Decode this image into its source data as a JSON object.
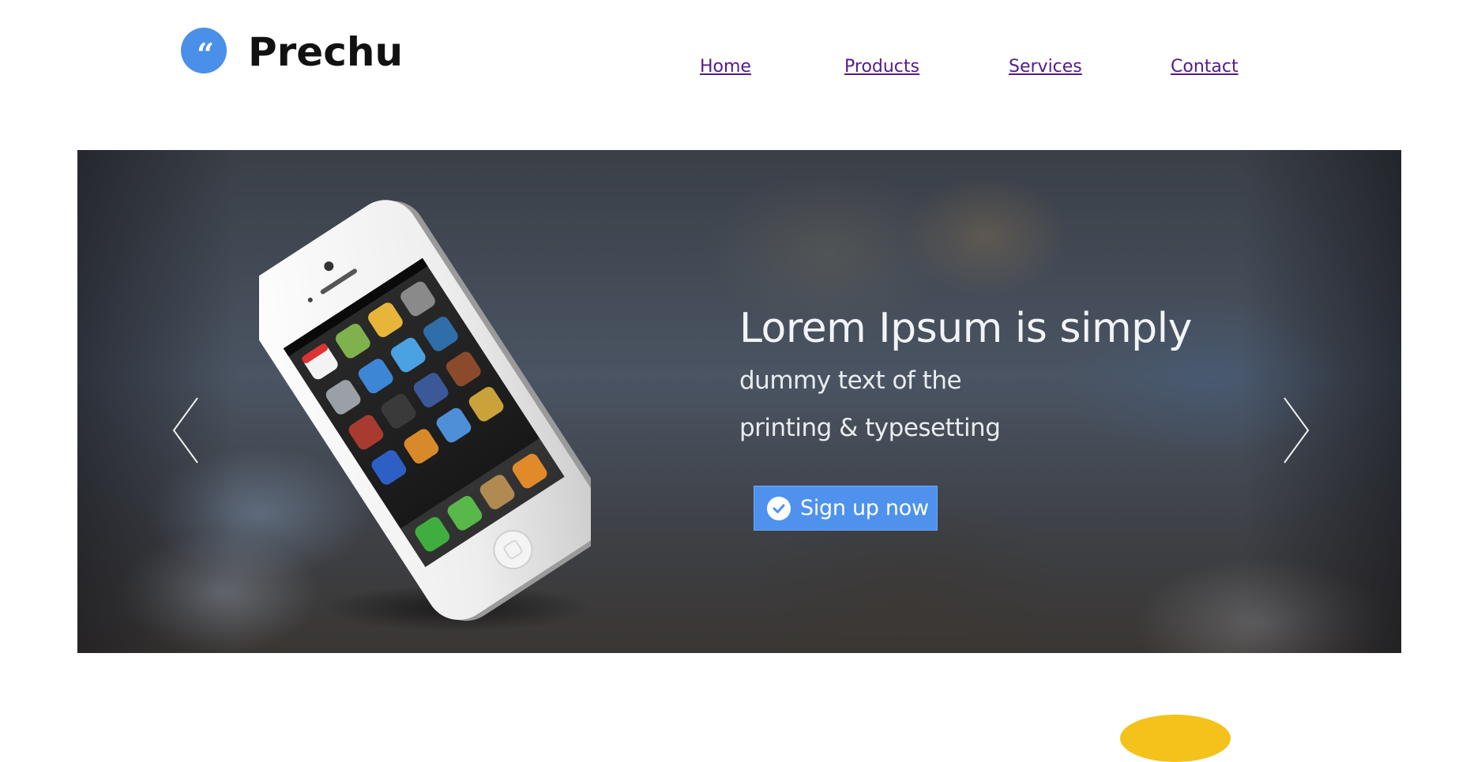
{
  "header": {
    "logo_glyph": "“",
    "brand": "Prechu",
    "nav": [
      "Home",
      "Products",
      "Services",
      "Contact"
    ]
  },
  "slider": {
    "headline": "Lorem Ipsum is simply",
    "sub_line_1": "dummy text of the",
    "sub_line_2": "printing & typesetting",
    "cta_label": "Sign up now"
  },
  "colors": {
    "accent": "#4a8fe8",
    "link": "#551a8b",
    "cta": "#4e92ee",
    "peek": "#f4c21a"
  }
}
